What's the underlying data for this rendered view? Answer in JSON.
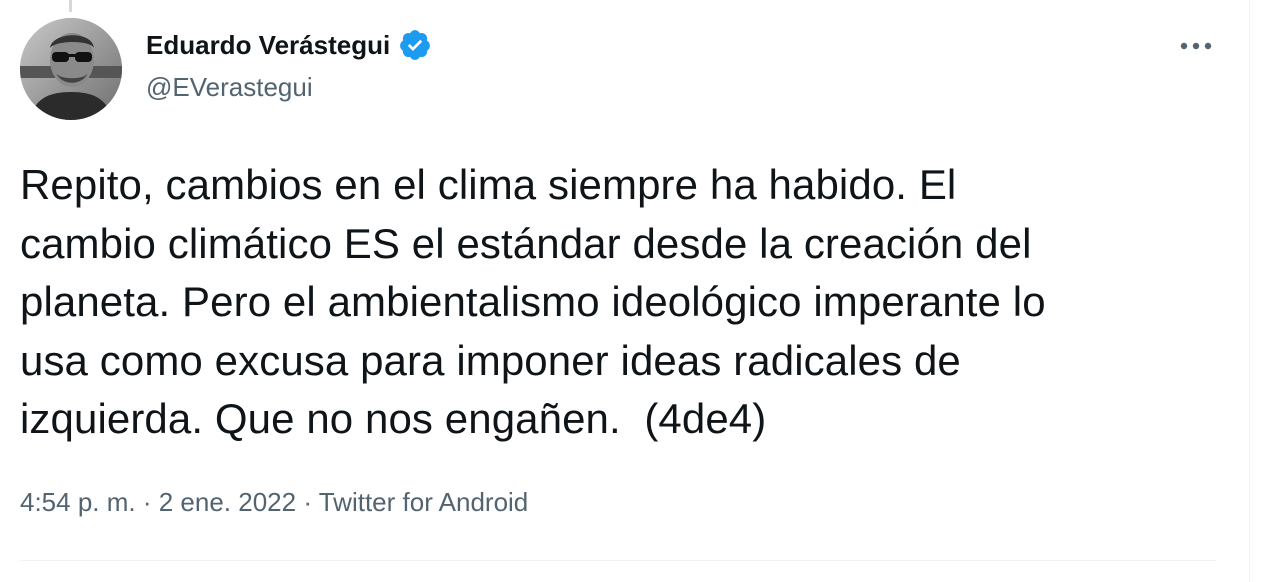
{
  "thread": {
    "author": {
      "display_name": "Eduardo Verástegui",
      "handle": "@EVerastegui",
      "verified": true
    },
    "more_label": "•••",
    "text": "Repito, cambios en el clima siempre ha habido. El\ncambio climático ES el estándar desde la creación del\nplaneta. Pero el ambientalismo ideológico imperante lo\nusa como excusa para imponer ideas radicales de\nizquierda. Que no nos engañen.  (4de4)",
    "meta": {
      "time": "4:54 p. m.",
      "separator1": " · ",
      "date": "2 ene. 2022",
      "separator2": " · ",
      "source": "Twitter for Android"
    }
  },
  "colors": {
    "text_primary": "#0f1419",
    "text_secondary": "#536471",
    "verified": "#1d9bf0",
    "divider": "#eff3f4"
  },
  "icons": {
    "verified": "verified-badge-icon",
    "more": "more-horizontal-icon"
  }
}
